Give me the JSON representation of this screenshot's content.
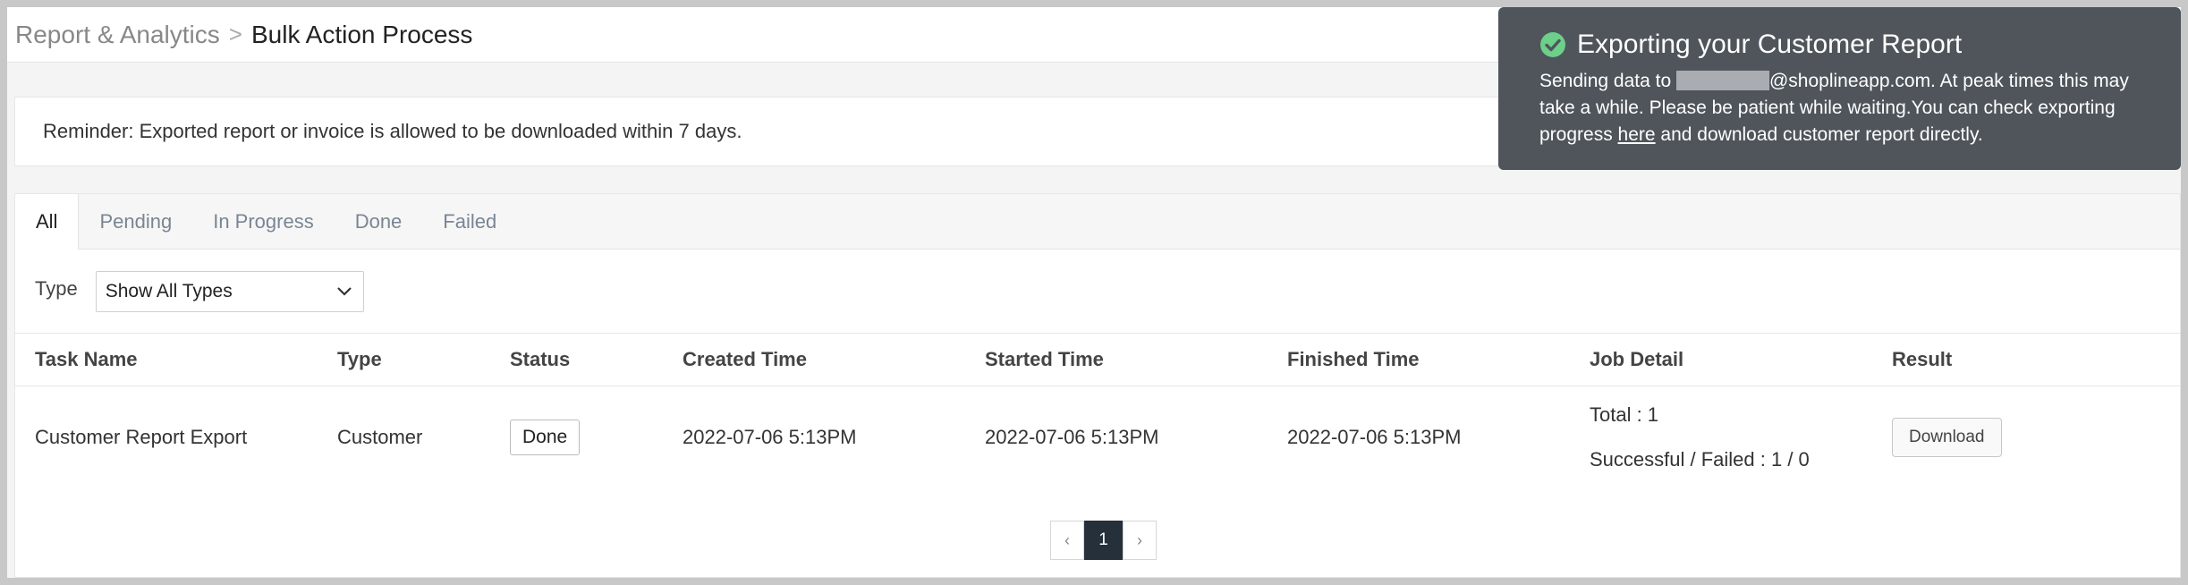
{
  "breadcrumb": {
    "parent": "Report & Analytics",
    "separator": ">",
    "current": "Bulk Action Process"
  },
  "reminder": "Reminder: Exported report or invoice is allowed to be downloaded within 7 days.",
  "tabs": [
    "All",
    "Pending",
    "In Progress",
    "Done",
    "Failed"
  ],
  "active_tab": "All",
  "filter": {
    "label": "Type",
    "selected": "Show All Types"
  },
  "table": {
    "columns": [
      "Task Name",
      "Type",
      "Status",
      "Created Time",
      "Started Time",
      "Finished Time",
      "Job Detail",
      "Result"
    ],
    "rows": [
      {
        "task_name": "Customer Report Export",
        "type": "Customer",
        "status": "Done",
        "created": "2022-07-06 5:13PM",
        "started": "2022-07-06 5:13PM",
        "finished": "2022-07-06 5:13PM",
        "job_total": "Total : 1",
        "job_result": "Successful / Failed : 1 / 0",
        "action": "Download"
      }
    ]
  },
  "pagination": {
    "prev": "‹",
    "current": "1",
    "next": "›"
  },
  "toast": {
    "title": "Exporting your Customer Report",
    "body_prefix": "Sending data to",
    "email_domain": "@shoplineapp.com.",
    "body_middle": "At peak times this may take a while. Please be patient while waiting.You can check exporting progress",
    "link": "here",
    "body_suffix": "and download customer report directly.",
    "icon": "check-circle-icon",
    "icon_color": "#6ccf8a"
  }
}
